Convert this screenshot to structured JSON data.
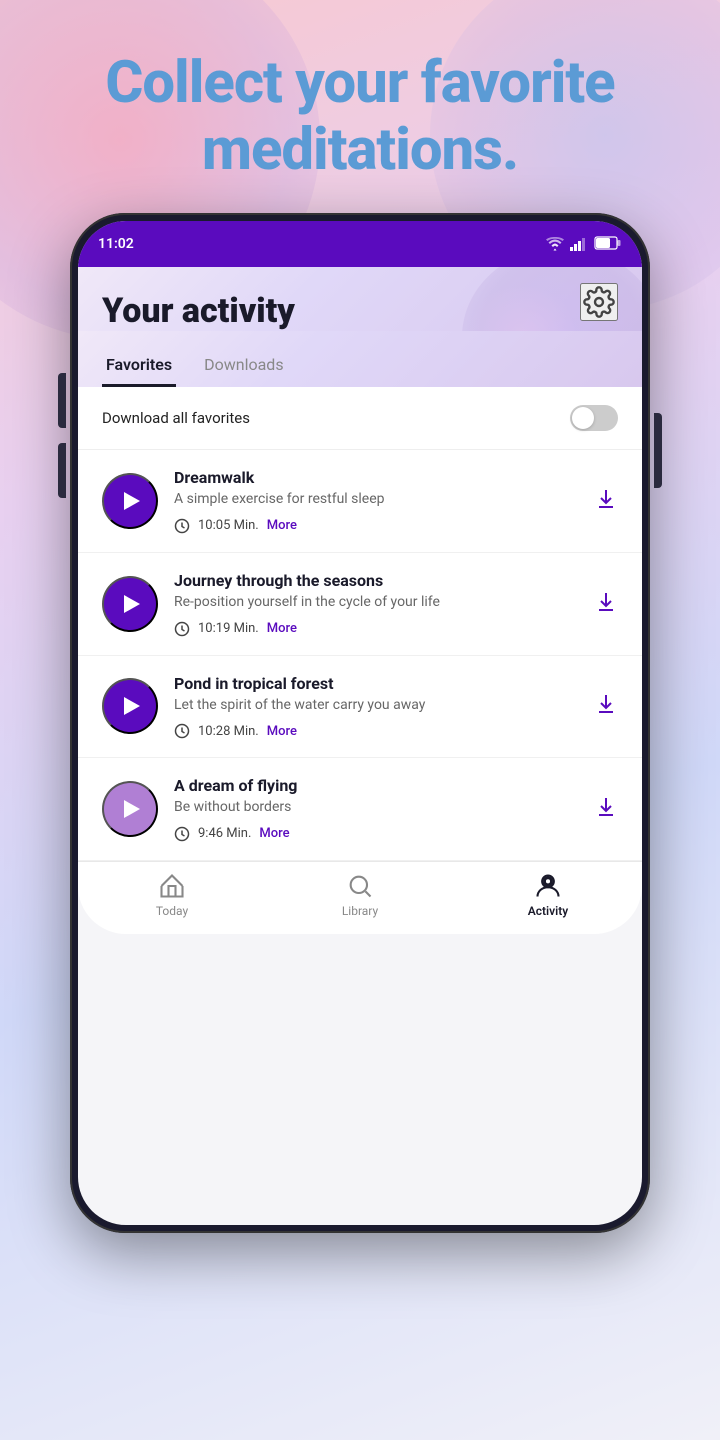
{
  "hero": {
    "title": "Collect your favorite meditations."
  },
  "statusBar": {
    "time": "11:02",
    "battery": "61%"
  },
  "header": {
    "title": "Your activity",
    "settingsLabel": "Settings"
  },
  "tabs": [
    {
      "id": "favorites",
      "label": "Favorites",
      "active": true
    },
    {
      "id": "downloads",
      "label": "Downloads",
      "active": false
    }
  ],
  "downloadAll": {
    "label": "Download all favorites"
  },
  "meditations": [
    {
      "id": "dreamwalk",
      "title": "Dreamwalk",
      "subtitle": "A simple exercise for restful sleep",
      "duration": "10:05 Min.",
      "moreLabel": "More",
      "playColor": "dark"
    },
    {
      "id": "journey-seasons",
      "title": "Journey through the seasons",
      "subtitle": "Re-position yourself in the cycle of your life",
      "duration": "10:19 Min.",
      "moreLabel": "More",
      "playColor": "dark"
    },
    {
      "id": "pond-forest",
      "title": "Pond in tropical forest",
      "subtitle": "Let the spirit of the water carry you away",
      "duration": "10:28 Min.",
      "moreLabel": "More",
      "playColor": "dark"
    },
    {
      "id": "dream-flying",
      "title": "A dream of flying",
      "subtitle": "Be without borders",
      "duration": "9:46 Min.",
      "moreLabel": "More",
      "playColor": "light"
    }
  ],
  "bottomNav": [
    {
      "id": "today",
      "label": "Today",
      "active": false,
      "icon": "home"
    },
    {
      "id": "library",
      "label": "Library",
      "active": false,
      "icon": "search"
    },
    {
      "id": "activity",
      "label": "Activity",
      "active": true,
      "icon": "activity"
    }
  ]
}
